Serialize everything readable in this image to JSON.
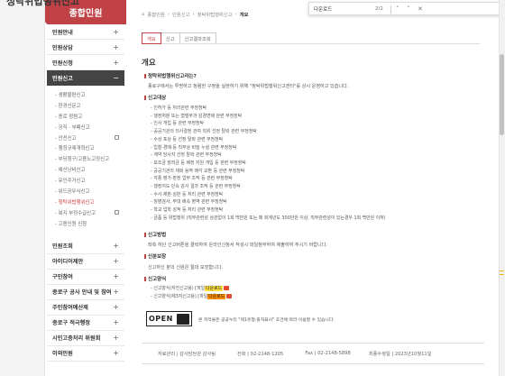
{
  "sidebar": {
    "title": "종합민원",
    "items_top": [
      {
        "label": "민원안내",
        "icon": "+"
      },
      {
        "label": "민원상담",
        "icon": "+"
      },
      {
        "label": "민원신청",
        "icon": "+"
      }
    ],
    "active": {
      "label": "민원신고",
      "icon": "−"
    },
    "sub": [
      {
        "label": "- 생활불편신고",
        "ext": false
      },
      {
        "label": "- 환경신문고",
        "ext": false
      },
      {
        "label": "- 종로 청렴고",
        "ext": false
      },
      {
        "label": "- 공직 · 부패신고",
        "ext": false
      },
      {
        "label": "- 안전신고",
        "ext": true
      },
      {
        "label": "- 행정규제개혁신고",
        "ext": false
      },
      {
        "label": "- 부당청구/고용노고정신고",
        "ext": false
      },
      {
        "label": "- 예산낭비신고",
        "ext": false
      },
      {
        "label": "- 유인주거신고",
        "ext": false
      },
      {
        "label": "- 위드공무식신고",
        "ext": false
      },
      {
        "label": "- 청탁위법행위신고",
        "ext": false,
        "current": true
      },
      {
        "label": "- 복지 부정수급신고",
        "ext": true
      },
      {
        "label": "- 고용인원 신청",
        "ext": false
      }
    ],
    "items_bottom": [
      {
        "label": "민원조회",
        "icon": "+"
      },
      {
        "label": "아이디어제안",
        "icon": "+"
      },
      {
        "label": "구민참여",
        "icon": "+"
      },
      {
        "label": "종로구 공사 안내 및 참여",
        "icon": "+"
      },
      {
        "label": "주민참여예산제",
        "icon": "+"
      },
      {
        "label": "종로구 적극행정",
        "icon": "+"
      },
      {
        "label": "시민고충처리 위원회",
        "icon": "+"
      },
      {
        "label": "이의민원",
        "icon": "+"
      }
    ]
  },
  "page": {
    "title": "청탁위법행위신고",
    "breadcrumb": [
      "⌂",
      "종합민원",
      "민원신고",
      "청탁위법행위신고"
    ],
    "breadcrumb_current": "개요",
    "tabs": [
      "개요",
      "신고",
      "신고결과조회"
    ]
  },
  "find": {
    "query": "다운로드",
    "count": "2/2"
  },
  "content": {
    "heading": "개요",
    "s1_title": "청탁위법행위신고라는?",
    "s1_text": "종로구에서는 투명하고 청렴한 구정을 실현하기 위해 \"청탁위법행위신고센터\"를 상시 운영하고 있습니다.",
    "s2_title": "신고대상",
    "s2_items": [
      "- 인허가 등 처리관련 부정청탁",
      "- 행정처분 또는 형벌부과 감경면제 관련 부정청탁",
      "- 인사 개입 등 관련 부정청탁",
      "- 공공기관의 의사결정 관여 직위 선정 탈락 관련 부정청탁",
      "- 수상 포상 등 선정 탈락 관련 부정청탁",
      "- 입찰·경매·등 직무상 비밀 누설 관련 부정청탁",
      "- 계약 당사자 선정 탈락 관련 부정청탁",
      "- 보조금 장려금 등 배정 지원 개입 등 관련 부정청탁",
      "- 공공기관의 재화 용역 매각 교환 등 관련 부정청탁",
      "- 각종 평가·판정 업무 조작 등 관련 부정청탁",
      "- 행정지도 단속 감사 결과 조작 등 관련 부정청탁",
      "- 수사·재판·심판 등 처리 관련 부정청탁",
      "- 징병검사, 부대 배속 병역 관련 부정청탁",
      "- 학교 입학 성적 등 처리 관련 부정청탁",
      "- 금품 등 위법행위 (직무관련성 상관없이 1회 백만원 또는 매 회계년도 300만원 이상, 직무관련성이 있는경우 1회 백만원 이하)"
    ],
    "s3_title": "신고방법",
    "s3_text": "좌측 하단 신고버튼을 클릭하여 온라인신청서 작성시 파일첨부하여 제출하여 주시기 바랍니다.",
    "s4_title": "신분보장",
    "s4_text": "신고하신 분의 신원은 절대 보장합니다.",
    "s5_title": "신고양식",
    "s5_items": [
      {
        "prefix": "- 신고양식(자진신고용) [파일",
        "hl": "다운로드",
        "suffix": ""
      },
      {
        "prefix": "- 신고양식(제3자신고용) [파일",
        "hl": "다운로드",
        "suffix": ""
      }
    ],
    "open_label": "OPEN",
    "open_text": "본 저작물은 공공누리 \"제1유형:출처표시\" 조건에 따라 이용할 수 있습니다."
  },
  "footer": {
    "dept": "자료관리 | 감사담당관 감사팀",
    "tel": "전화 | 02-2148-1205",
    "fax": "Fax | 02-2148-5898",
    "date": "최종수정일 | 2023년10월11일"
  }
}
